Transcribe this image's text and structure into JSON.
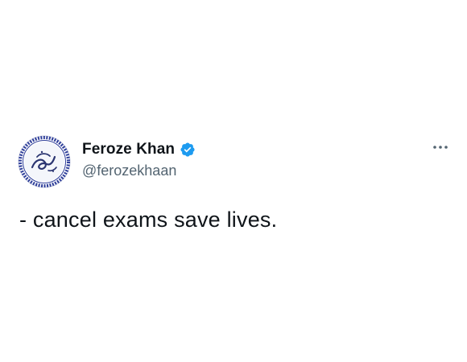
{
  "tweet": {
    "author": {
      "display_name": "Feroze Khan",
      "handle": "@ferozekhaan",
      "verified": true,
      "avatar_icon": "calligraphy-seal-avatar"
    },
    "text": "- cancel exams save lives.",
    "more_icon": "more-horizontal-icon"
  },
  "colors": {
    "text_primary": "#0f1419",
    "text_secondary": "#536471",
    "verified_blue": "#1d9bf0",
    "avatar_blue": "#2f3f9a"
  }
}
